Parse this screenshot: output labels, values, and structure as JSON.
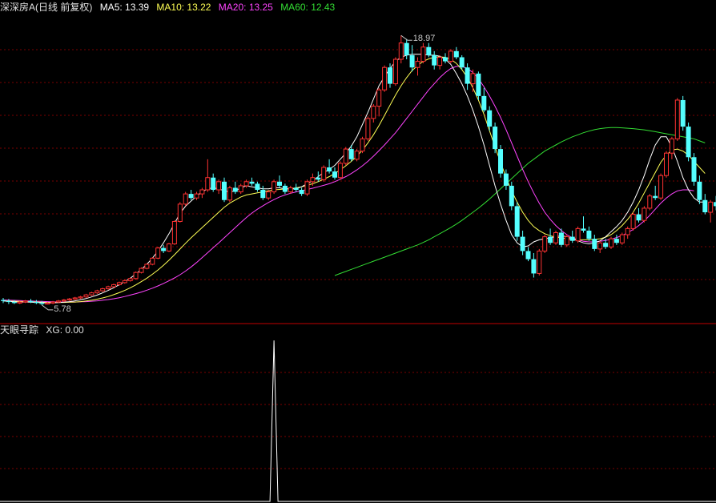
{
  "main_panel": {
    "stock_name": "深深房A",
    "period": "(日线 前复权)",
    "indicators": [
      {
        "label": "MA5: 13.39",
        "color": "#ffffff"
      },
      {
        "label": "MA10: 13.22",
        "color": "#ffff55"
      },
      {
        "label": "MA20: 13.25",
        "color": "#ff44ff"
      },
      {
        "label": "MA60: 12.43",
        "color": "#33dd33"
      }
    ],
    "high_label": "18.97",
    "low_label": "5.78"
  },
  "sub_panel": {
    "name": "天眼寻踪",
    "indicator": "XG: 0.00"
  },
  "colors": {
    "up": "#ff3232",
    "down": "#54ffff",
    "grid": "#7a0000",
    "divider": "#c00000",
    "background": "#000000"
  },
  "chart_data": {
    "type": "candlestick",
    "y_range": [
      5.0,
      20.0
    ],
    "candles": [
      [
        6.0,
        6.1,
        5.85,
        5.95
      ],
      [
        5.95,
        6.05,
        5.8,
        5.9
      ],
      [
        5.9,
        6.0,
        5.8,
        5.85
      ],
      [
        5.85,
        5.95,
        5.8,
        5.9
      ],
      [
        5.9,
        6.0,
        5.85,
        5.95
      ],
      [
        5.95,
        6.05,
        5.85,
        5.9
      ],
      [
        5.9,
        6.0,
        5.8,
        5.85
      ],
      [
        5.85,
        5.95,
        5.75,
        5.8
      ],
      [
        5.8,
        5.9,
        5.78,
        5.85
      ],
      [
        5.85,
        5.95,
        5.8,
        5.9
      ],
      [
        5.9,
        6.0,
        5.85,
        5.95
      ],
      [
        5.95,
        6.05,
        5.9,
        6.0
      ],
      [
        6.0,
        6.1,
        5.95,
        6.05
      ],
      [
        6.05,
        6.15,
        6.0,
        6.1
      ],
      [
        6.1,
        6.2,
        6.05,
        6.15
      ],
      [
        6.15,
        6.3,
        6.1,
        6.25
      ],
      [
        6.25,
        6.4,
        6.2,
        6.35
      ],
      [
        6.35,
        6.5,
        6.3,
        6.45
      ],
      [
        6.45,
        6.6,
        6.4,
        6.55
      ],
      [
        6.55,
        6.7,
        6.5,
        6.65
      ],
      [
        6.65,
        6.8,
        6.6,
        6.75
      ],
      [
        6.75,
        6.9,
        6.7,
        6.85
      ],
      [
        6.85,
        7.0,
        6.8,
        6.95
      ],
      [
        6.95,
        7.1,
        6.9,
        7.05
      ],
      [
        7.05,
        7.4,
        7.0,
        7.35
      ],
      [
        7.35,
        7.6,
        7.3,
        7.55
      ],
      [
        7.55,
        7.8,
        7.5,
        7.75
      ],
      [
        7.75,
        8.1,
        7.7,
        8.05
      ],
      [
        8.05,
        8.6,
        8.0,
        8.55
      ],
      [
        8.55,
        8.7,
        8.3,
        8.4
      ],
      [
        8.4,
        8.8,
        8.35,
        8.75
      ],
      [
        8.75,
        9.9,
        8.7,
        9.85
      ],
      [
        9.85,
        10.8,
        9.8,
        10.7
      ],
      [
        10.7,
        11.3,
        10.6,
        11.2
      ],
      [
        11.2,
        11.4,
        10.9,
        11.0
      ],
      [
        11.0,
        11.3,
        10.9,
        11.2
      ],
      [
        11.2,
        11.5,
        11.0,
        11.4
      ],
      [
        11.4,
        12.9,
        11.3,
        12.0
      ],
      [
        12.0,
        12.2,
        11.3,
        11.4
      ],
      [
        11.4,
        11.9,
        11.2,
        11.8
      ],
      [
        11.8,
        12.0,
        10.8,
        10.9
      ],
      [
        10.9,
        11.6,
        10.8,
        11.5
      ],
      [
        11.5,
        11.8,
        11.2,
        11.3
      ],
      [
        11.3,
        11.7,
        11.2,
        11.6
      ],
      [
        11.6,
        11.9,
        11.5,
        11.8
      ],
      [
        11.8,
        12.0,
        11.6,
        11.7
      ],
      [
        11.7,
        11.8,
        11.3,
        11.4
      ],
      [
        11.4,
        11.6,
        10.9,
        11.0
      ],
      [
        11.0,
        11.4,
        10.9,
        11.3
      ],
      [
        11.3,
        11.9,
        11.2,
        11.8
      ],
      [
        11.8,
        12.1,
        11.5,
        11.6
      ],
      [
        11.6,
        11.7,
        11.2,
        11.3
      ],
      [
        11.3,
        11.6,
        11.2,
        11.5
      ],
      [
        11.5,
        11.7,
        11.3,
        11.4
      ],
      [
        11.4,
        11.5,
        11.1,
        11.2
      ],
      [
        11.2,
        11.9,
        11.1,
        11.8
      ],
      [
        11.8,
        12.2,
        11.6,
        12.0
      ],
      [
        12.0,
        12.3,
        11.8,
        11.9
      ],
      [
        11.9,
        12.6,
        11.8,
        12.5
      ],
      [
        12.5,
        12.9,
        12.2,
        12.3
      ],
      [
        12.3,
        12.5,
        11.9,
        12.0
      ],
      [
        12.0,
        12.8,
        11.9,
        12.7
      ],
      [
        12.7,
        13.5,
        12.6,
        13.4
      ],
      [
        13.4,
        13.6,
        12.8,
        12.9
      ],
      [
        12.9,
        13.4,
        12.8,
        13.3
      ],
      [
        13.3,
        14.0,
        13.2,
        13.9
      ],
      [
        13.9,
        15.0,
        13.8,
        14.9
      ],
      [
        14.9,
        15.6,
        14.7,
        15.5
      ],
      [
        15.5,
        16.4,
        15.0,
        16.3
      ],
      [
        16.3,
        17.5,
        16.2,
        17.4
      ],
      [
        17.4,
        17.6,
        16.4,
        16.6
      ],
      [
        16.6,
        17.9,
        16.5,
        17.8
      ],
      [
        17.8,
        18.97,
        17.6,
        18.6
      ],
      [
        18.6,
        18.8,
        17.8,
        18.0
      ],
      [
        18.0,
        18.5,
        17.2,
        17.4
      ],
      [
        17.4,
        17.9,
        17.0,
        17.7
      ],
      [
        17.7,
        18.6,
        17.6,
        18.4
      ],
      [
        18.4,
        18.6,
        17.9,
        18.0
      ],
      [
        18.0,
        18.2,
        17.3,
        17.5
      ],
      [
        17.5,
        18.0,
        17.3,
        17.9
      ],
      [
        17.9,
        18.1,
        17.6,
        17.7
      ],
      [
        17.7,
        18.3,
        17.6,
        18.2
      ],
      [
        18.2,
        18.4,
        17.8,
        17.9
      ],
      [
        17.9,
        18.0,
        17.3,
        17.4
      ],
      [
        17.4,
        17.6,
        16.3,
        16.6
      ],
      [
        16.6,
        17.3,
        16.2,
        17.1
      ],
      [
        17.1,
        17.2,
        15.8,
        16.0
      ],
      [
        16.0,
        16.4,
        15.2,
        15.3
      ],
      [
        15.3,
        15.5,
        14.3,
        14.5
      ],
      [
        14.5,
        14.7,
        13.2,
        13.4
      ],
      [
        13.4,
        13.6,
        12.0,
        12.2
      ],
      [
        12.2,
        12.4,
        11.4,
        11.6
      ],
      [
        11.6,
        11.8,
        10.4,
        10.6
      ],
      [
        10.6,
        10.8,
        8.9,
        9.1
      ],
      [
        9.1,
        9.4,
        8.2,
        8.4
      ],
      [
        8.4,
        8.6,
        7.9,
        8.0
      ],
      [
        8.0,
        8.3,
        7.1,
        7.3
      ],
      [
        7.3,
        8.5,
        7.2,
        8.4
      ],
      [
        8.4,
        9.2,
        8.3,
        9.1
      ],
      [
        9.1,
        9.5,
        8.7,
        8.8
      ],
      [
        8.8,
        9.4,
        8.7,
        9.3
      ],
      [
        9.3,
        9.5,
        8.6,
        8.7
      ],
      [
        8.7,
        9.2,
        8.6,
        9.1
      ],
      [
        9.1,
        9.4,
        8.8,
        8.9
      ],
      [
        8.9,
        9.6,
        8.8,
        9.5
      ],
      [
        9.5,
        10.1,
        9.3,
        9.4
      ],
      [
        9.4,
        9.6,
        8.9,
        9.0
      ],
      [
        9.0,
        9.2,
        8.4,
        8.5
      ],
      [
        8.5,
        8.9,
        8.3,
        8.8
      ],
      [
        8.8,
        9.0,
        8.5,
        8.6
      ],
      [
        8.6,
        9.1,
        8.5,
        9.0
      ],
      [
        9.0,
        9.2,
        8.7,
        8.8
      ],
      [
        8.8,
        9.3,
        8.7,
        9.2
      ],
      [
        9.2,
        9.6,
        9.0,
        9.5
      ],
      [
        9.5,
        10.3,
        9.4,
        10.2
      ],
      [
        10.2,
        10.5,
        9.8,
        9.9
      ],
      [
        9.9,
        10.6,
        9.8,
        10.5
      ],
      [
        10.5,
        11.2,
        10.4,
        11.1
      ],
      [
        11.1,
        11.6,
        10.9,
        11.0
      ],
      [
        11.0,
        12.2,
        10.9,
        12.1
      ],
      [
        12.1,
        13.3,
        12.0,
        13.2
      ],
      [
        13.2,
        14.0,
        12.9,
        13.9
      ],
      [
        13.9,
        15.9,
        13.8,
        15.8
      ],
      [
        15.8,
        16.0,
        14.3,
        14.5
      ],
      [
        14.5,
        14.7,
        12.8,
        13.0
      ],
      [
        13.0,
        13.2,
        11.6,
        11.8
      ],
      [
        11.8,
        12.1,
        10.7,
        10.9
      ],
      [
        10.9,
        11.2,
        10.2,
        10.3
      ],
      [
        10.3,
        10.9,
        9.8,
        10.8
      ],
      [
        10.8,
        11.1,
        10.4,
        10.6
      ],
      [
        10.6,
        11.4,
        10.5,
        11.3
      ]
    ],
    "ma5": [
      5.95,
      5.93,
      5.91,
      5.9,
      5.9,
      5.89,
      5.88,
      5.87,
      5.86,
      5.86,
      5.87,
      5.89,
      5.92,
      5.96,
      6.01,
      6.07,
      6.15,
      6.24,
      6.35,
      6.47,
      6.6,
      6.75,
      6.9,
      7.07,
      7.27,
      7.5,
      7.75,
      8.05,
      8.4,
      8.8,
      9.25,
      9.75,
      10.25,
      10.6,
      10.85,
      11.1,
      11.3,
      11.45,
      11.5,
      11.45,
      11.35,
      11.3,
      11.35,
      11.5,
      11.6,
      11.55,
      11.5,
      11.45,
      11.45,
      11.5,
      11.5,
      11.45,
      11.45,
      11.45,
      11.55,
      11.7,
      11.85,
      12.05,
      12.25,
      12.4,
      12.6,
      12.9,
      13.2,
      13.55,
      14.0,
      14.6,
      15.2,
      15.85,
      16.5,
      16.95,
      17.35,
      17.7,
      17.9,
      18.0,
      18.05,
      18.05,
      18.05,
      18.0,
      18.0,
      17.95,
      17.8,
      17.55,
      17.1,
      16.6,
      16.0,
      15.3,
      14.5,
      13.6,
      12.6,
      11.6,
      10.7,
      9.9,
      9.2,
      8.8,
      8.6,
      8.65,
      8.85,
      8.95,
      9.0,
      9.05,
      9.1,
      9.15,
      9.1,
      9.0,
      8.9,
      8.8,
      8.75,
      8.8,
      8.9,
      9.1,
      9.35,
      9.6,
      9.9,
      10.3,
      10.8,
      11.4,
      12.1,
      12.9,
      13.6,
      14.0,
      14.0,
      13.5,
      12.8,
      12.0,
      11.4,
      11.0,
      10.8,
      10.8
    ],
    "ma10": [
      5.96,
      5.95,
      5.94,
      5.93,
      5.92,
      5.91,
      5.9,
      5.89,
      5.88,
      5.88,
      5.88,
      5.88,
      5.89,
      5.9,
      5.92,
      5.95,
      5.99,
      6.04,
      6.1,
      6.17,
      6.26,
      6.36,
      6.47,
      6.6,
      6.74,
      6.9,
      7.07,
      7.26,
      7.47,
      7.7,
      7.95,
      8.22,
      8.5,
      8.78,
      9.05,
      9.3,
      9.55,
      9.8,
      10.05,
      10.3,
      10.55,
      10.75,
      10.9,
      11.05,
      11.15,
      11.2,
      11.25,
      11.3,
      11.35,
      11.4,
      11.42,
      11.44,
      11.46,
      11.5,
      11.55,
      11.62,
      11.7,
      11.8,
      11.92,
      12.05,
      12.2,
      12.38,
      12.58,
      12.8,
      13.05,
      13.35,
      13.7,
      14.1,
      14.55,
      15.05,
      15.55,
      16.05,
      16.5,
      16.9,
      17.25,
      17.5,
      17.7,
      17.82,
      17.9,
      17.92,
      17.9,
      17.8,
      17.6,
      17.3,
      16.9,
      16.4,
      15.8,
      15.1,
      14.3,
      13.5,
      12.75,
      12.0,
      11.35,
      10.8,
      10.3,
      9.9,
      9.6,
      9.4,
      9.25,
      9.15,
      9.08,
      9.05,
      9.0,
      8.98,
      8.96,
      8.95,
      8.95,
      8.97,
      9.0,
      9.08,
      9.2,
      9.4,
      9.65,
      9.95,
      10.3,
      10.75,
      11.25,
      11.75,
      12.25,
      12.75,
      13.1,
      13.35,
      13.4,
      13.3,
      13.1,
      12.8,
      12.5,
      12.2
    ],
    "ma20": [
      6.0,
      5.99,
      5.98,
      5.97,
      5.96,
      5.95,
      5.94,
      5.93,
      5.92,
      5.91,
      5.9,
      5.9,
      5.9,
      5.9,
      5.91,
      5.92,
      5.94,
      5.96,
      5.99,
      6.02,
      6.06,
      6.11,
      6.17,
      6.24,
      6.31,
      6.39,
      6.48,
      6.58,
      6.69,
      6.81,
      6.94,
      7.08,
      7.24,
      7.42,
      7.62,
      7.84,
      8.08,
      8.32,
      8.56,
      8.8,
      9.05,
      9.3,
      9.55,
      9.8,
      10.04,
      10.26,
      10.45,
      10.62,
      10.78,
      10.92,
      11.05,
      11.15,
      11.23,
      11.3,
      11.36,
      11.42,
      11.48,
      11.55,
      11.62,
      11.7,
      11.8,
      11.92,
      12.05,
      12.2,
      12.38,
      12.58,
      12.8,
      13.05,
      13.32,
      13.6,
      13.9,
      14.2,
      14.55,
      14.9,
      15.25,
      15.6,
      15.95,
      16.3,
      16.6,
      16.9,
      17.15,
      17.35,
      17.45,
      17.45,
      17.35,
      17.15,
      16.85,
      16.45,
      16.0,
      15.5,
      14.95,
      14.35,
      13.7,
      13.05,
      12.4,
      11.8,
      11.25,
      10.75,
      10.3,
      9.95,
      9.65,
      9.4,
      9.2,
      9.05,
      8.95,
      8.88,
      8.85,
      8.85,
      8.88,
      8.92,
      8.98,
      9.06,
      9.16,
      9.3,
      9.46,
      9.65,
      9.88,
      10.15,
      10.45,
      10.75,
      11.0,
      11.2,
      11.35,
      11.4,
      11.4,
      11.35
    ],
    "ma60": [
      null,
      null,
      null,
      null,
      null,
      null,
      null,
      null,
      null,
      null,
      null,
      null,
      null,
      null,
      null,
      null,
      null,
      null,
      null,
      null,
      null,
      null,
      null,
      null,
      null,
      null,
      null,
      null,
      null,
      null,
      null,
      null,
      null,
      null,
      null,
      null,
      null,
      null,
      null,
      null,
      null,
      null,
      null,
      null,
      null,
      null,
      null,
      null,
      null,
      null,
      null,
      null,
      null,
      null,
      null,
      null,
      null,
      null,
      null,
      null,
      7.2,
      7.3,
      7.4,
      7.5,
      7.6,
      7.7,
      7.8,
      7.9,
      8.0,
      8.1,
      8.2,
      8.3,
      8.4,
      8.5,
      8.6,
      8.7,
      8.82,
      8.95,
      9.1,
      9.25,
      9.4,
      9.55,
      9.72,
      9.9,
      10.1,
      10.3,
      10.5,
      10.72,
      10.95,
      11.2,
      11.45,
      11.7,
      11.95,
      12.2,
      12.45,
      12.7,
      12.9,
      13.1,
      13.3,
      13.45,
      13.6,
      13.75,
      13.88,
      14.0,
      14.1,
      14.2,
      14.28,
      14.35,
      14.4,
      14.43,
      14.45,
      14.45,
      14.44,
      14.42,
      14.4,
      14.37,
      14.34,
      14.3,
      14.25,
      14.2,
      14.15,
      14.1,
      14.05,
      14.0,
      13.95,
      13.9,
      13.8,
      13.7
    ],
    "xg_spike_index": 49
  }
}
